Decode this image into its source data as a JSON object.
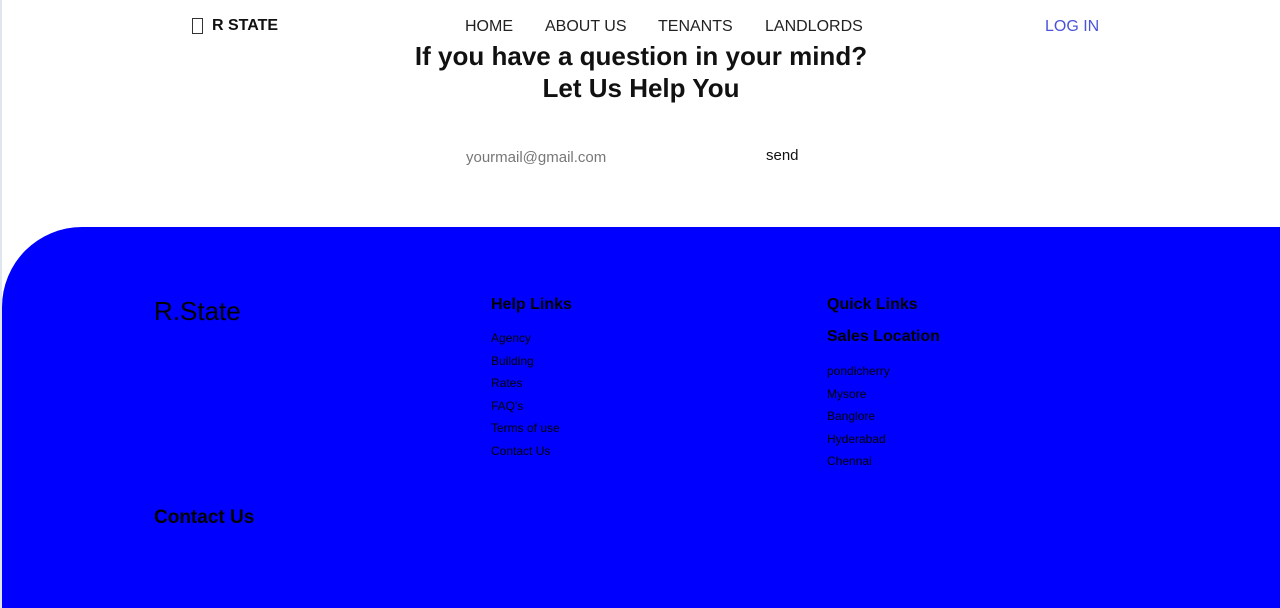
{
  "header": {
    "brand": "R STATE",
    "nav": {
      "home": "HOME",
      "about": "ABOUT US",
      "tenants": "TENANTS",
      "landlords": "LANDLORDS"
    },
    "login": "LOG IN"
  },
  "hero": {
    "title_line_1": "If you have a question in your mind?",
    "title_line_2": "Let Us Help You",
    "email_placeholder": "yourmail@gmail.com",
    "send_label": "send"
  },
  "footer": {
    "brand": "R.State",
    "help_links": {
      "heading": "Help Links",
      "items": [
        "Agency",
        "Building",
        "Rates",
        "FAQ's",
        "Terms of use",
        "Contact Us"
      ]
    },
    "quick_links": {
      "heading": "Quick Links",
      "subheading": "Sales Location",
      "locations": [
        "pondicherry",
        "Mysore",
        "Banglore",
        "Hyderabad",
        "Chennai"
      ]
    },
    "contact_heading": "Contact Us"
  },
  "colors": {
    "footer_background": "#0000ff",
    "login_link": "#4a54d8"
  },
  "icons": {
    "brand_icon": "house-outline-icon"
  }
}
